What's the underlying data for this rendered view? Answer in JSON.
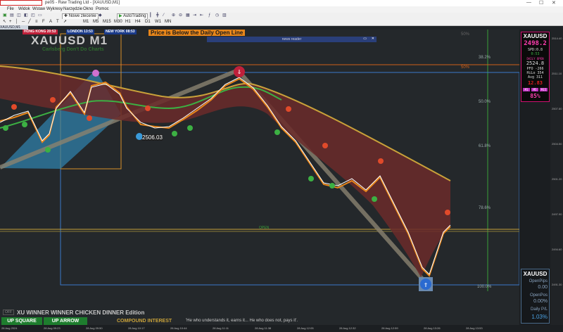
{
  "window": {
    "title": "pe05 - Raw Trading Ltd - [XAUUSD,M1]"
  },
  "menu": [
    "File",
    "Widok",
    "Wstaw",
    "Wykresy",
    "Narzędzie",
    "Okno",
    "Pomoc"
  ],
  "toolbar": {
    "new_order": "Nowe zlecenie",
    "autotrading": "AutoTrading",
    "timeframes": [
      "M1",
      "M5",
      "M15",
      "M30",
      "H1",
      "H4",
      "D1",
      "W1",
      "MN"
    ]
  },
  "chart_tab": "XAUUSD,M1",
  "sessions": [
    {
      "label": "HONG KONG 20:53",
      "color": "#c0203a"
    },
    {
      "label": "LONDON 13:53",
      "color": "#1a3a8a"
    },
    {
      "label": "NEW YORK 08:53",
      "color": "#1a3a8a"
    }
  ],
  "alert_banner": "Price is Below the Daily Open Line",
  "symbol_title": "XAUUSD M1",
  "subtitle": "Carlsberg Don't Do Charts",
  "news_reader": "news reader",
  "fib_levels": [
    {
      "label": "50%"
    },
    {
      "label": "38.2%"
    },
    {
      "label": "50%"
    },
    {
      "label": "50.0%"
    },
    {
      "label": "61.8%"
    },
    {
      "label": "78.6%"
    },
    {
      "label": "100.0%"
    }
  ],
  "price_label": "2506.03",
  "open_label": "OPEN",
  "info_panel": {
    "symbol": "XAUUSD",
    "price": "2498.2",
    "spd_label": "SPD:0.8",
    "timer": "0:53",
    "daily_open_label": "DAILY OPEN",
    "daily_open": "2524.8",
    "pfo": "PFO -266",
    "hilo": "HiLo 354",
    "avg": "Avg 311",
    "value_red": "12.83",
    "tf_buttons": [
      "M1",
      "M5",
      "M15"
    ],
    "percent": "85%"
  },
  "pnl_panel": {
    "symbol": "XAUUSD",
    "open_pips_label": "OpenPips",
    "open_pips": "0.00",
    "open_pos_label": "OpenPos",
    "open_pos": "0.00%",
    "daily_pl_label": "Daily P/L",
    "daily_pl": "1.03%"
  },
  "bottom": {
    "off_label": "OFF",
    "edition": "XU WINNER WINNER CHICKEN DINNER Edition",
    "up_square": "UP SQUARE",
    "up_arrow": "UP ARROW",
    "compound": "COMPOUND INTEREST",
    "quote": "'He who understands it, earns it... He who does not, pays it'."
  },
  "price_scale": [
    "2514.40",
    "2511.10",
    "2507.80",
    "2504.50",
    "2501.20",
    "2497.90",
    "2494.60",
    "2491.30"
  ],
  "time_axis": [
    "28 Aug 2024",
    "28 Aug 09:23",
    "28 Aug 09:50",
    "28 Aug 10:17",
    "28 Aug 10:44",
    "28 Aug 11:11",
    "28 Aug 11:38",
    "28 Aug 12:05",
    "28 Aug 12:32",
    "28 Aug 12:59",
    "28 Aug 13:26",
    "28 Aug 13:53"
  ],
  "colors": {
    "bull": "#ffffff",
    "bear": "#e8861a",
    "band_fill": "#6b2a2a",
    "ma": "#c9a23a",
    "green_ma": "#3cb043",
    "fib_blue": "#3a78c9",
    "fib_orange": "#e8861a"
  }
}
